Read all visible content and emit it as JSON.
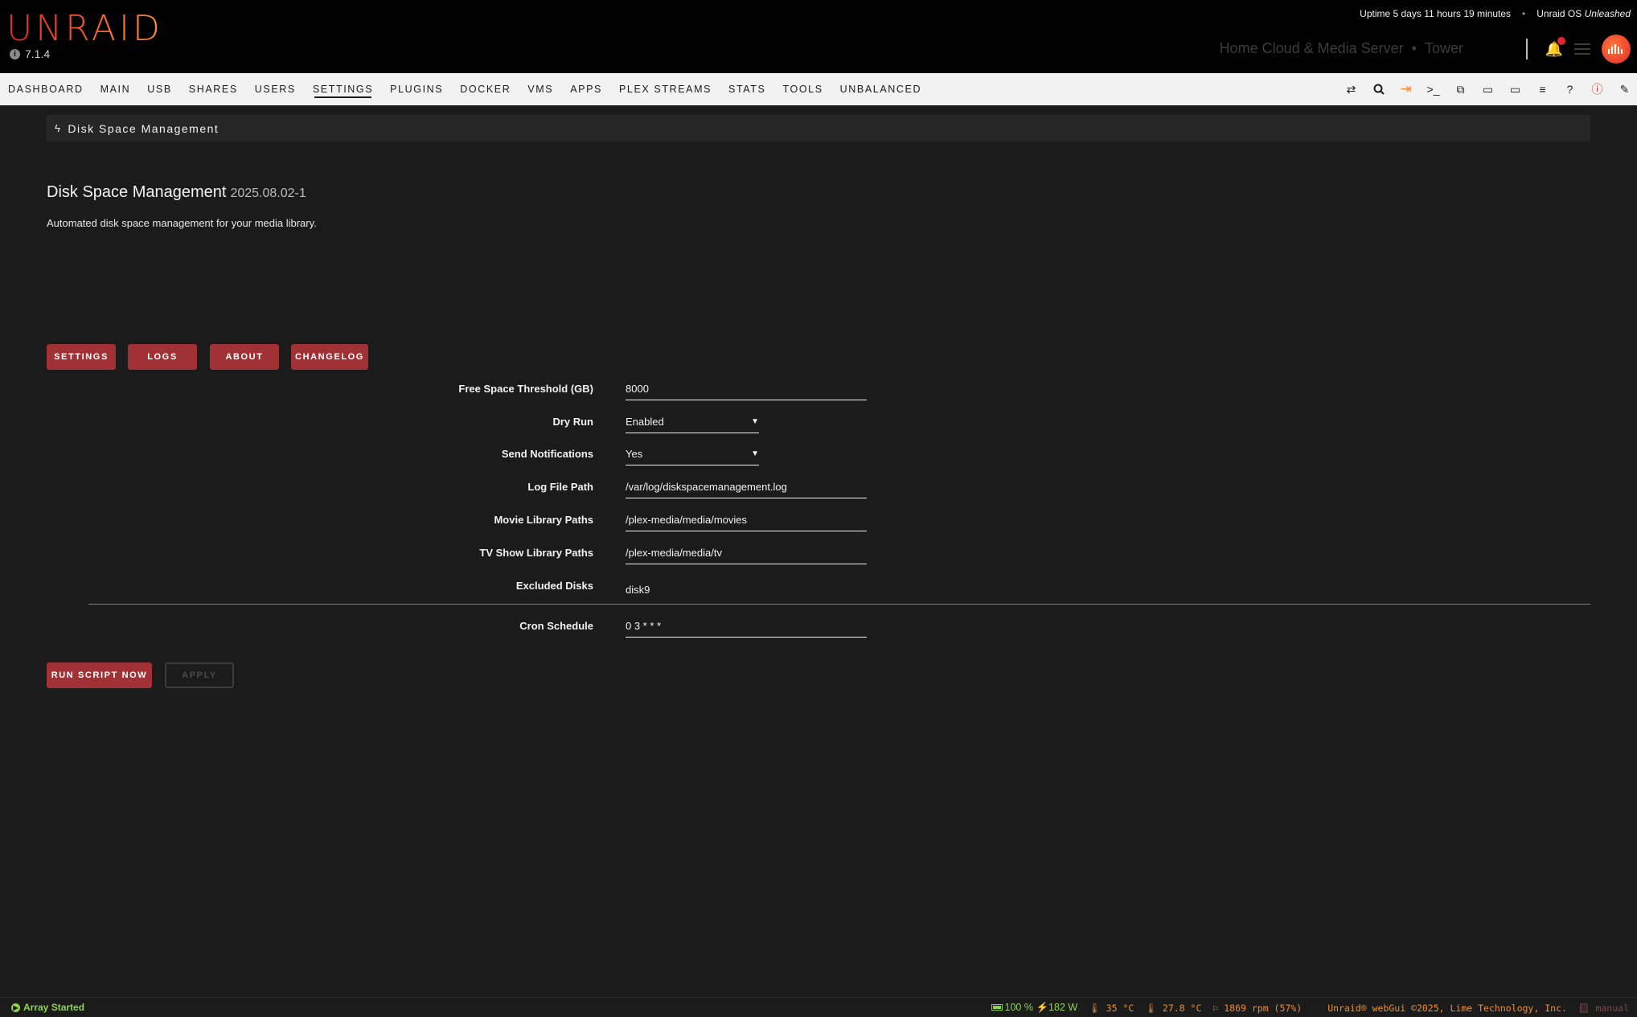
{
  "header": {
    "logo_text": "UNRAID",
    "version": "7.1.4",
    "uptime": "Uptime 5 days 11 hours 19 minutes",
    "os_label": "Unraid OS",
    "os_edition": "Unleashed",
    "server_description": "Home Cloud & Media Server",
    "server_separator": "•",
    "server_name": "Tower"
  },
  "nav": {
    "tabs": [
      {
        "label": "DASHBOARD"
      },
      {
        "label": "MAIN"
      },
      {
        "label": "USB"
      },
      {
        "label": "SHARES"
      },
      {
        "label": "USERS"
      },
      {
        "label": "SETTINGS",
        "active": true
      },
      {
        "label": "PLUGINS"
      },
      {
        "label": "DOCKER"
      },
      {
        "label": "VMS"
      },
      {
        "label": "APPS"
      },
      {
        "label": "PLEX STREAMS"
      },
      {
        "label": "STATS"
      },
      {
        "label": "TOOLS"
      },
      {
        "label": "UNBALANCED"
      }
    ],
    "icons": [
      "switch-icon",
      "search-icon",
      "logout-icon",
      "terminal-icon",
      "copy-icon",
      "feedback-icon",
      "monitor-icon",
      "log-icon",
      "help-icon",
      "info-icon",
      "edit-icon"
    ]
  },
  "page": {
    "title_bar": "Disk Space Management",
    "plugin_name": "Disk Space Management",
    "plugin_version": "2025.08.02-1",
    "description": "Automated disk space management for your media library."
  },
  "tab_buttons": {
    "settings": "SETTINGS",
    "logs": "LOGS",
    "about": "ABOUT",
    "changelog": "CHANGELOG"
  },
  "form": {
    "free_space": {
      "label": "Free Space Threshold (GB)",
      "value": "8000"
    },
    "dry_run": {
      "label": "Dry Run",
      "value": "Enabled"
    },
    "notifications": {
      "label": "Send Notifications",
      "value": "Yes"
    },
    "log_path": {
      "label": "Log File Path",
      "value": "/var/log/diskspacemanagement.log"
    },
    "movie_paths": {
      "label": "Movie Library Paths",
      "value": "/plex-media/media/movies"
    },
    "tv_paths": {
      "label": "TV Show Library Paths",
      "value": "/plex-media/media/tv"
    },
    "excluded_disks": {
      "label": "Excluded Disks",
      "value": "disk9"
    },
    "cron": {
      "label": "Cron Schedule",
      "value": "0 3 * * *"
    }
  },
  "actions": {
    "run": "RUN SCRIPT NOW",
    "apply": "APPLY"
  },
  "footer": {
    "array_status": "Array Started",
    "battery": "100 %",
    "power": "182 W",
    "cpu_temp": "35 °C",
    "board_temp": "27.8 °C",
    "fan": "1869 rpm (57%)",
    "copyright": "Unraid® webGui ©2025, Lime Technology, Inc.",
    "manual": "manual"
  },
  "colors": {
    "accent_red": "#a13134",
    "brand_orange": "#ff8c2f",
    "status_green": "#8fd14f"
  }
}
